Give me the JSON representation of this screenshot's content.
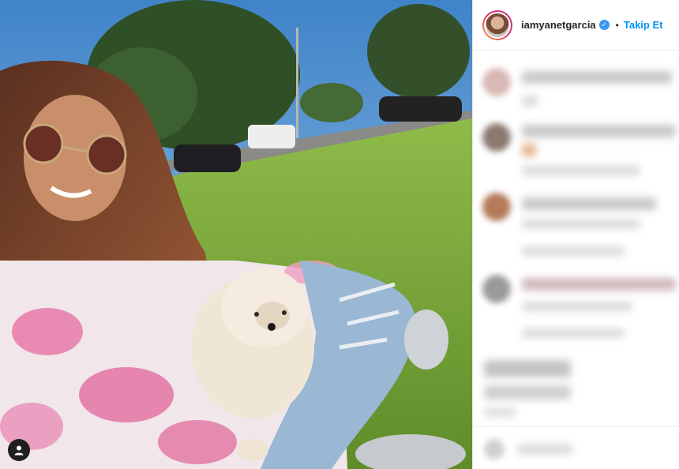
{
  "post": {
    "photo_description_icon": "photo",
    "user_tag_icon": "user-icon"
  },
  "header": {
    "username": "iamyanetgarcia",
    "verified_icon": "verified-badge-icon",
    "separator": "•",
    "follow_label": "Takip Et"
  },
  "comments": {
    "blurred": true
  },
  "colors": {
    "accent": "#0095f6",
    "verified": "#3897f0"
  }
}
